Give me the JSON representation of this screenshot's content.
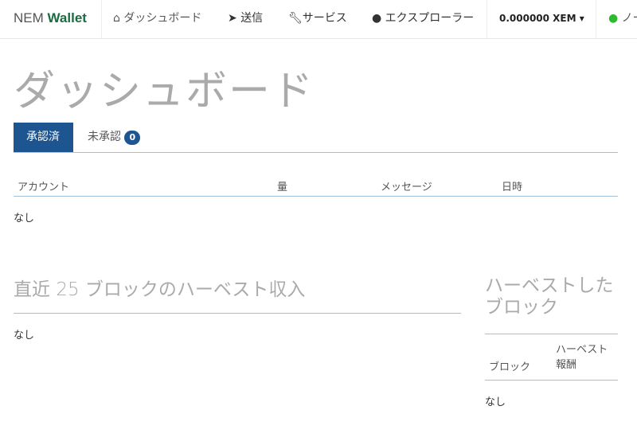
{
  "nav": {
    "brand_a": "NEM",
    "brand_b": "Wallet",
    "dashboard": "ダッシュボード",
    "send": "送信",
    "services": "サービス",
    "explorer": "エクスプローラー",
    "balance": "0.000000 XEM",
    "node": "ノー"
  },
  "page_title": "ダッシュボード",
  "tabs": [
    {
      "label": "承認済"
    },
    {
      "label": "未承認",
      "badge": "0"
    }
  ],
  "table": {
    "headers": [
      "アカウント",
      "量",
      "メッセージ",
      "日時"
    ],
    "empty": "なし"
  },
  "harvest": {
    "title_a": "直近",
    "title_num": "25",
    "title_b": "ブロックのハーベスト収入",
    "empty": "なし"
  },
  "harvested": {
    "title": "ハーベストした\nブロック",
    "col_block": "ブロック",
    "col_reward": "ハーベスト報酬",
    "empty": "なし"
  },
  "colors": {
    "accent": "#1d5590",
    "brand": "#1a6b41",
    "node_status": "#2dbb2d"
  }
}
